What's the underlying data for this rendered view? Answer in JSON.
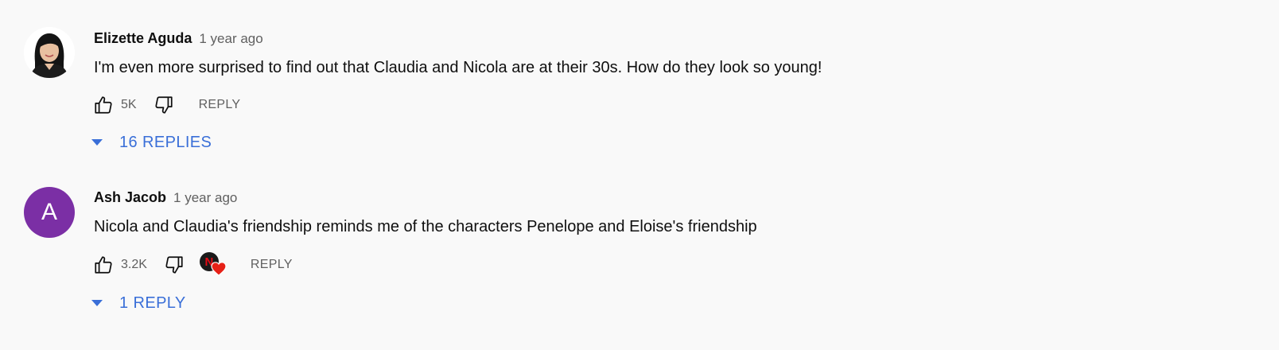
{
  "colors": {
    "background": "#f9f9f9",
    "text_primary": "#0f0f0f",
    "text_secondary": "#606060",
    "link_blue": "#3a6fd8",
    "avatar_purple": "#7b2fa5",
    "heart_red": "#e62117"
  },
  "comments": [
    {
      "author": "Elizette Aguda",
      "time": "1 year ago",
      "text": "I'm even more surprised to find out that Claudia and Nicola are at their 30s. How do they look so young!",
      "avatar": "profile-photo",
      "like_count": "5K",
      "reply_label": "REPLY",
      "replies_label": "16 REPLIES",
      "creator_hearted": false
    },
    {
      "author": "Ash Jacob",
      "time": "1 year ago",
      "text": "Nicola and Claudia's friendship reminds me of the characters Penelope and Eloise's friendship",
      "avatar_letter": "A",
      "like_count": "3.2K",
      "reply_label": "REPLY",
      "replies_label": "1 REPLY",
      "creator_hearted": true,
      "creator_badge_letter": "N"
    }
  ],
  "icons": {
    "like": "thumbs-up-icon",
    "dislike": "thumbs-down-icon",
    "expand": "triangle-down-icon",
    "heart": "heart-icon"
  }
}
